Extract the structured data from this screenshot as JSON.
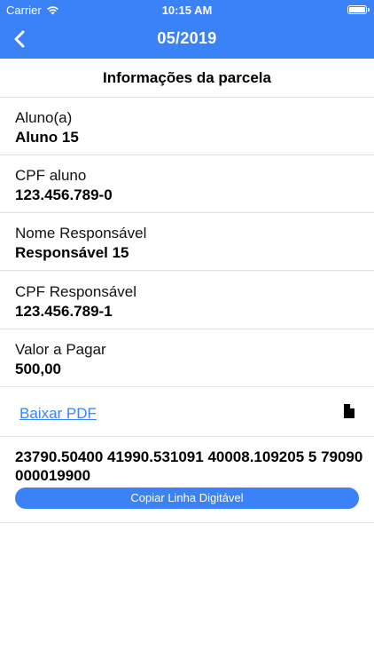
{
  "status_bar": {
    "carrier": "Carrier",
    "time": "10:15 AM",
    "battery_level": 1.0
  },
  "nav": {
    "title": "05/2019"
  },
  "section": {
    "title": "Informações da parcela"
  },
  "fields": [
    {
      "label": "Aluno(a)",
      "value": "Aluno 15"
    },
    {
      "label": "CPF aluno",
      "value": "123.456.789-0"
    },
    {
      "label": "Nome Responsável",
      "value": "Responsável 15"
    },
    {
      "label": "CPF Responsável",
      "value": "123.456.789-1"
    },
    {
      "label": "Valor a Pagar",
      "value": "500,00"
    }
  ],
  "pdf": {
    "link_label": "Baixar PDF",
    "icon": "document-icon"
  },
  "barcode": {
    "line": "23790.50400 41990.531091 40008.109205 5 79090000019900",
    "copy_label": "Copiar Linha Digitável"
  },
  "colors": {
    "accent": "#3b82f6",
    "divider": "#e0e0e0"
  }
}
